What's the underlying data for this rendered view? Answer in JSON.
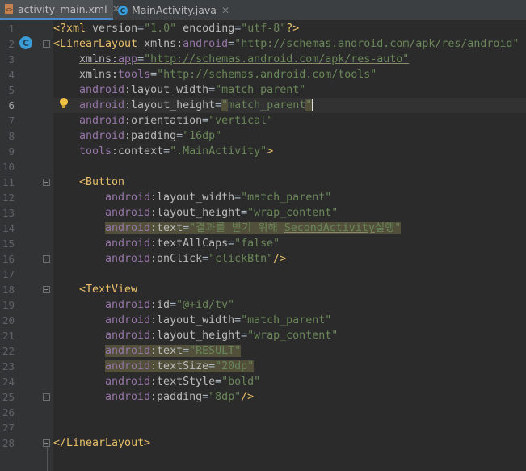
{
  "tabs": [
    {
      "label": "activity_main.xml",
      "icon": "xml-file-icon",
      "active": true
    },
    {
      "label": "MainActivity.java",
      "icon": "java-class-icon",
      "active": false
    }
  ],
  "gutter": {
    "line_numbers": [
      "1",
      "2",
      "3",
      "4",
      "5",
      "6",
      "7",
      "8",
      "9",
      "10",
      "11",
      "12",
      "13",
      "14",
      "15",
      "16",
      "17",
      "18",
      "19",
      "20",
      "21",
      "22",
      "23",
      "24",
      "25",
      "26",
      "27",
      "28"
    ],
    "current_line": "6",
    "class_marker": "C"
  },
  "code": {
    "l1": {
      "a": "<?xml ",
      "b": "version",
      "c": "=",
      "d": "\"1.0\"",
      "e": " ",
      "f": "encoding",
      "g": "=",
      "h": "\"utf-8\"",
      "i": "?>"
    },
    "l2": {
      "a": "<LinearLayout ",
      "b": "xmlns:",
      "c": "android",
      "d": "=",
      "e": "\"http://schemas.android.com/apk/res/android\""
    },
    "l3": {
      "a": "xmlns:",
      "b": "app",
      "c": "=",
      "d": "\"http://schemas.android.com/apk/res-auto\""
    },
    "l4": {
      "a": "xmlns:",
      "b": "tools",
      "c": "=",
      "d": "\"http://schemas.android.com/tools\""
    },
    "l5": {
      "ns": "android",
      "attr": ":layout_width",
      "eq": "=",
      "val": "\"match_parent\""
    },
    "l6": {
      "ns": "android",
      "attr": ":layout_height",
      "eq": "=",
      "q1": "\"",
      "v": "match_parent",
      "q2": "\""
    },
    "l7": {
      "ns": "android",
      "attr": ":orientation",
      "eq": "=",
      "val": "\"vertical\""
    },
    "l8": {
      "ns": "android",
      "attr": ":padding",
      "eq": "=",
      "val": "\"16dp\""
    },
    "l9": {
      "ns": "tools",
      "attr": ":context",
      "eq": "=",
      "val": "\".MainActivity\"",
      "end": ">"
    },
    "l11": {
      "tag": "<Button"
    },
    "l12": {
      "ns": "android",
      "attr": ":layout_width",
      "eq": "=",
      "val": "\"match_parent\""
    },
    "l13": {
      "ns": "android",
      "attr": ":layout_height",
      "eq": "=",
      "val": "\"wrap_content\""
    },
    "l14": {
      "ns": "android",
      "attr": ":text",
      "eq": "=",
      "v1": "\"결과를 받기 위해 ",
      "v2": "SecondActivity",
      "v3": "실행\""
    },
    "l15": {
      "ns": "android",
      "attr": ":textAllCaps",
      "eq": "=",
      "val": "\"false\""
    },
    "l16": {
      "ns": "android",
      "attr": ":onClick",
      "eq": "=",
      "val": "\"clickBtn\"",
      "end": "/>"
    },
    "l18": {
      "tag": "<TextView"
    },
    "l19": {
      "ns": "android",
      "attr": ":id",
      "eq": "=",
      "val": "\"@+id/tv\""
    },
    "l20": {
      "ns": "android",
      "attr": ":layout_width",
      "eq": "=",
      "val": "\"match_parent\""
    },
    "l21": {
      "ns": "android",
      "attr": ":layout_height",
      "eq": "=",
      "val": "\"wrap_content\""
    },
    "l22": {
      "ns": "android",
      "attr": ":text",
      "eq": "=",
      "val": "\"RESULT\""
    },
    "l23": {
      "ns": "android",
      "attr": ":textSize",
      "eq": "=",
      "val": "\"20dp\""
    },
    "l24": {
      "ns": "android",
      "attr": ":textStyle",
      "eq": "=",
      "val": "\"bold\""
    },
    "l25": {
      "ns": "android",
      "attr": ":padding",
      "eq": "=",
      "val": "\"8dp\"",
      "end": "/>"
    },
    "l28": {
      "tag": "</LinearLayout>"
    }
  },
  "colors": {
    "background": "#2b2b2b",
    "tag": "#e8bf6a",
    "namespace": "#9876aa",
    "attribute": "#bababa",
    "string": "#6a8759",
    "highlight": "#52503a"
  }
}
